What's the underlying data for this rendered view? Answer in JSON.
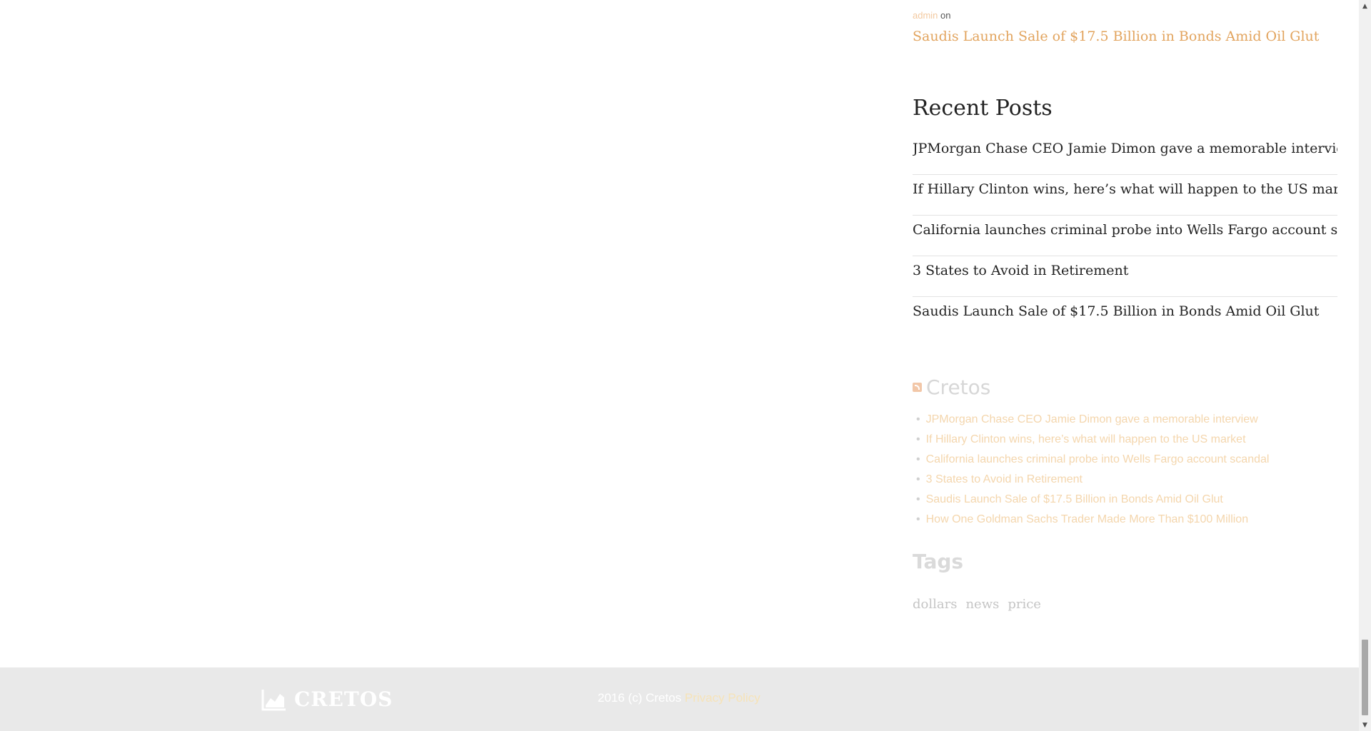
{
  "recent_comments": {
    "author": "admin",
    "on_text": "on",
    "post_link": "Saudis Launch Sale of $17.5 Billion in Bonds Amid Oil Glut"
  },
  "recent_posts": {
    "title": "Recent Posts",
    "items": [
      "JPMorgan Chase CEO Jamie Dimon gave a memorable interview",
      "If Hillary Clinton wins, here’s what will happen to the US market",
      "California launches criminal probe into Wells Fargo account scandal",
      "3 States to Avoid in Retirement",
      "Saudis Launch Sale of $17.5 Billion in Bonds Amid Oil Glut"
    ]
  },
  "rss_widget": {
    "title": "Cretos",
    "icon": "rss-icon",
    "items": [
      "JPMorgan Chase CEO Jamie Dimon gave a memorable interview",
      "If Hillary Clinton wins, here’s what will happen to the US market",
      "California launches criminal probe into Wells Fargo account scandal",
      "3 States to Avoid in Retirement",
      "Saudis Launch Sale of $17.5 Billion in Bonds Amid Oil Glut",
      "How One Goldman Sachs Trader Made More Than $100 Million"
    ]
  },
  "tags_widget": {
    "title": "Tags",
    "tags": [
      "dollars",
      "news",
      "price"
    ]
  },
  "footer": {
    "logo_text": "CRETOS",
    "logo_icon": "chart-icon",
    "copyright": "2016 (c) Cretos",
    "privacy_link": "Privacy Policy"
  },
  "colors": {
    "accent": "#e2a45e",
    "footer_bg": "#e9e9e9"
  }
}
